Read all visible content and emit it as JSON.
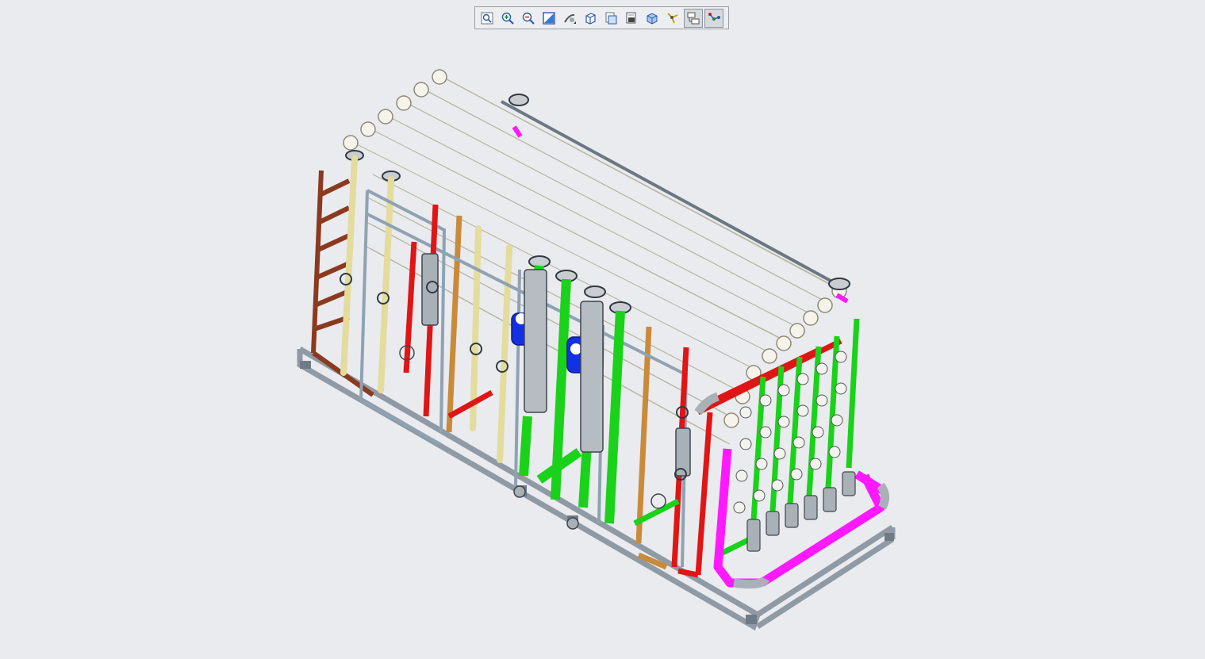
{
  "toolbar": {
    "buttons": [
      {
        "icon": "fit-all-icon",
        "active": false
      },
      {
        "icon": "zoom-in-icon",
        "active": false
      },
      {
        "icon": "zoom-out-icon",
        "active": false
      },
      {
        "icon": "zoom-area-icon",
        "active": false
      },
      {
        "icon": "pan-rotate-icon",
        "active": false
      },
      {
        "icon": "view-orientation-icon",
        "active": false
      },
      {
        "icon": "display-style-icon",
        "active": false
      },
      {
        "icon": "section-view-icon",
        "active": false
      },
      {
        "icon": "view-cube-icon",
        "active": false
      },
      {
        "icon": "explode-icon",
        "active": false
      },
      {
        "icon": "tree-toggle-icon",
        "active": true
      },
      {
        "icon": "connect-icon",
        "active": true
      }
    ]
  },
  "model": {
    "description_colors": {
      "vessel": "#f2efdf",
      "frame": "#9aa6b0",
      "green_pipe": "#19d219",
      "red_pipe": "#e01515",
      "magenta_pipe": "#ff19ff",
      "yellow_pipe": "#e3dc9c",
      "brown_pipe": "#8b3a1f",
      "orange_pipe": "#c98a3a",
      "blue_pump": "#1430e6",
      "grey_part": "#a9b0b6"
    }
  }
}
